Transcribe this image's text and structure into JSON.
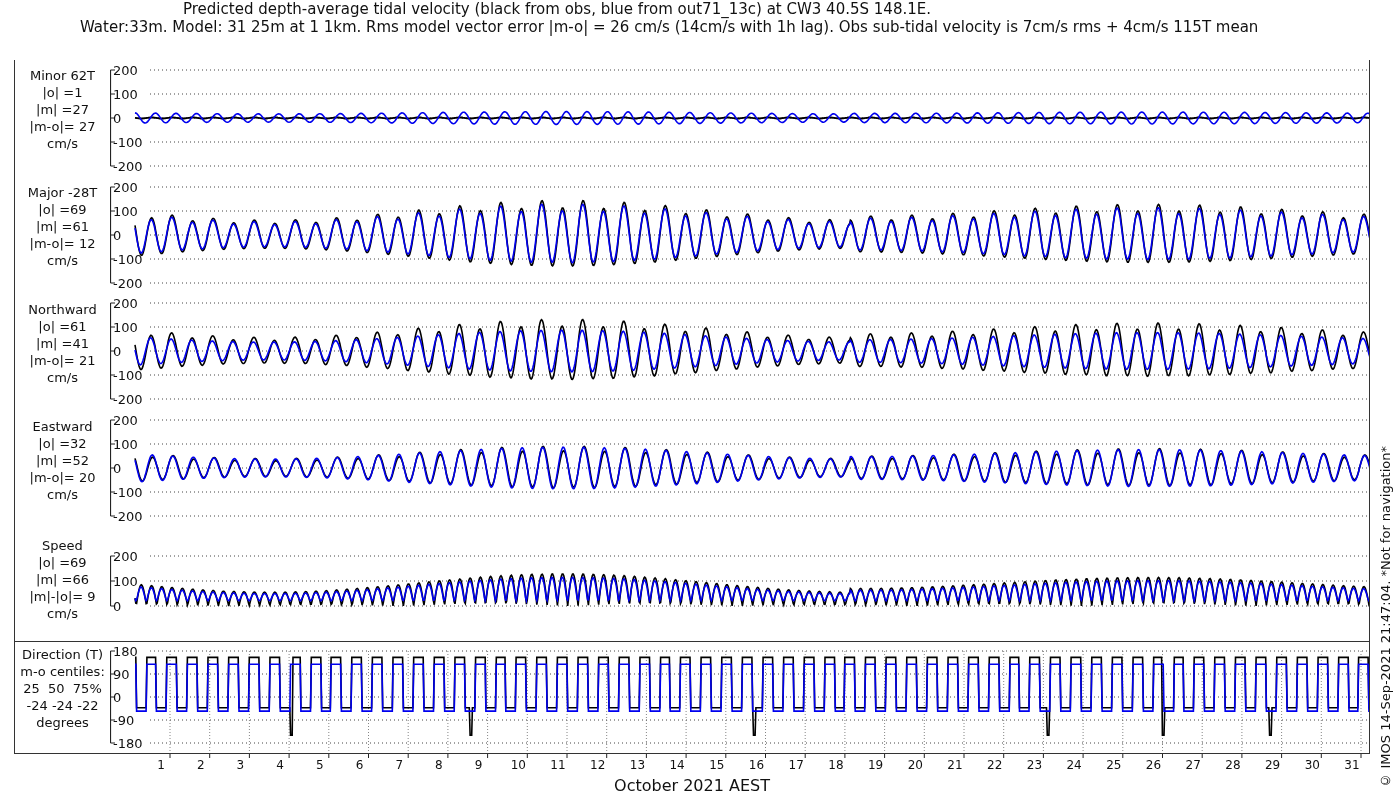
{
  "title": {
    "line_1": "Predicted depth-average tidal velocity (black from obs, blue from out71_13c) at CW3 40.5S 148.1E.",
    "line_2": "Water:33m. Model: 31 25m at 1 1km. Rms model vector error |m-o| = 26 cm/s (14cm/s with 1h lag). Obs sub-tidal velocity is 7cm/s rms + 4cm/s 115T mean"
  },
  "panels": [
    {
      "kind": "minor",
      "label": [
        "Minor 62T",
        "|o| =1",
        "|m| =27",
        "|m-o|= 27",
        "cm/s"
      ],
      "yticks": [
        "200",
        "100",
        "0",
        "-100",
        "-200"
      ]
    },
    {
      "kind": "major",
      "label": [
        "Major -28T",
        "|o| =69",
        "|m| =61",
        "|m-o|= 12",
        "cm/s"
      ],
      "yticks": [
        "200",
        "100",
        "0",
        "-100",
        "-200"
      ]
    },
    {
      "kind": "north",
      "label": [
        "Northward",
        "|o| =61",
        "|m| =41",
        "|m-o|= 21",
        "cm/s"
      ],
      "yticks": [
        "200",
        "100",
        "0",
        "-100",
        "-200"
      ]
    },
    {
      "kind": "east",
      "label": [
        "Eastward",
        "|o| =32",
        "|m| =52",
        "|m-o|= 20",
        "cm/s"
      ],
      "yticks": [
        "200",
        "100",
        "0",
        "-100",
        "-200"
      ]
    },
    {
      "kind": "speed",
      "label": [
        "Speed",
        "|o| =69",
        "|m| =66",
        "|m|-|o|= 9",
        "cm/s"
      ],
      "yticks": [
        "200",
        "100",
        "0"
      ]
    },
    {
      "kind": "direction",
      "label": [
        "Direction (T)",
        "m-o centiles:",
        "25  50  75%",
        "-24 -24 -22",
        "degrees"
      ],
      "yticks": [
        "180",
        "90",
        "0",
        "-90",
        "-180"
      ]
    }
  ],
  "x_axis": {
    "ticks": [
      "1",
      "2",
      "3",
      "4",
      "5",
      "6",
      "7",
      "8",
      "9",
      "10",
      "11",
      "12",
      "13",
      "14",
      "15",
      "16",
      "17",
      "18",
      "19",
      "20",
      "21",
      "22",
      "23",
      "24",
      "25",
      "26",
      "27",
      "28",
      "29",
      "30",
      "31"
    ],
    "label": "October 2021 AEST"
  },
  "footer": "© IMOS 14-Sep-2021 21:47:04. *Not for navigation*"
}
